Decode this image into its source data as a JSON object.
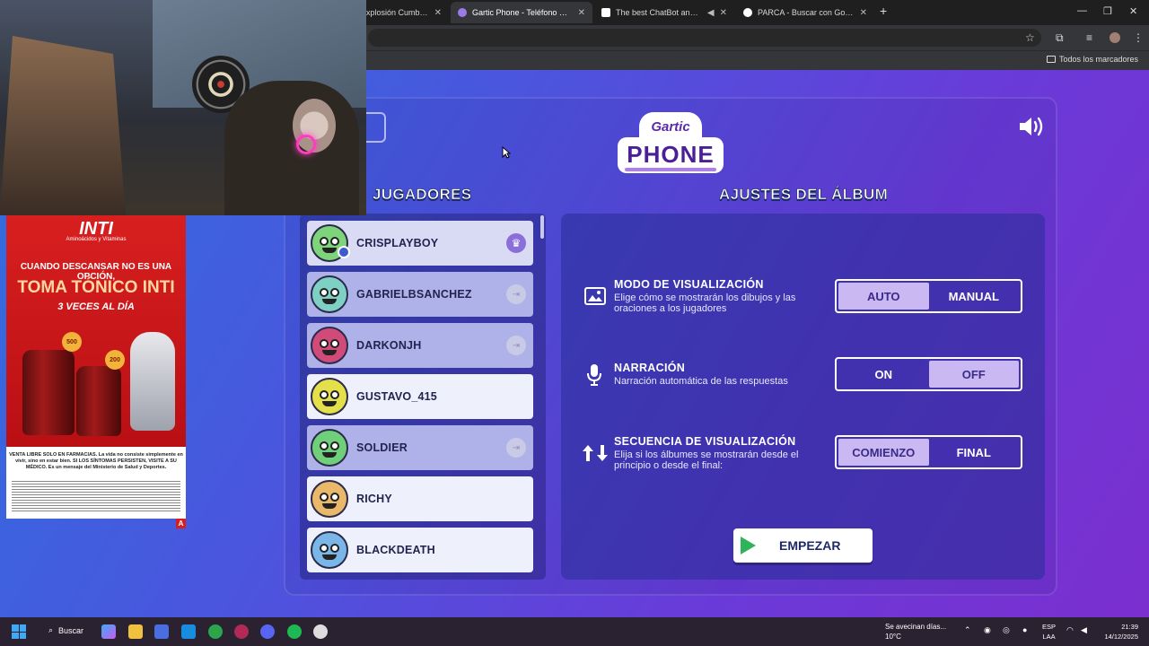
{
  "browser": {
    "tabs": [
      {
        "title": "xplosión Cumbiera",
        "active": false
      },
      {
        "title": "Gartic Phone - Teléfono Descon",
        "active": true
      },
      {
        "title": "The best ChatBot and Widg",
        "active": false
      },
      {
        "title": "PARCA - Buscar con Google",
        "active": false
      }
    ],
    "bookmarks_label": "Todos los marcadores"
  },
  "game": {
    "logo_top": "Gartic",
    "logo_bottom": "PHONE",
    "players_heading": "JUGADORES",
    "settings_heading": "AJUSTES DEL ÁLBUM",
    "players": [
      {
        "name": "CRISPLAYBOY",
        "color": "#7ed47a",
        "role": "host"
      },
      {
        "name": "GABRIELBSANCHEZ",
        "color": "#7fd0c4",
        "role": "kick"
      },
      {
        "name": "DARKONJH",
        "color": "#d04a7a",
        "role": "kick"
      },
      {
        "name": "GUSTAVO_415",
        "color": "#e3e04a",
        "role": "none"
      },
      {
        "name": "SOLDIER",
        "color": "#6fcf7a",
        "role": "kick"
      },
      {
        "name": "RICHY",
        "color": "#e9b86a",
        "role": "none"
      },
      {
        "name": "BLACKDEATH",
        "color": "#7ab7e8",
        "role": "none"
      }
    ],
    "settings": [
      {
        "title": "MODO DE VISUALIZACIÓN",
        "desc": "Elige cómo se mostrarán los dibujos y las oraciones a los jugadores",
        "options": [
          "AUTO",
          "MANUAL"
        ],
        "selected": 0,
        "icon": "image-icon"
      },
      {
        "title": "NARRACIÓN",
        "desc": "Narración automática de las respuestas",
        "options": [
          "ON",
          "OFF"
        ],
        "selected": 1,
        "icon": "microphone-icon"
      },
      {
        "title": "SECUENCIA DE VISUALIZACIÓN",
        "desc": "Elija si los álbumes se mostrarán desde el principio o desde el final:",
        "options": [
          "COMIENZO",
          "FINAL"
        ],
        "selected": 0,
        "icon": "sort-arrows-icon"
      }
    ],
    "start_label": "EMPEZAR"
  },
  "ad": {
    "brand": "INTI",
    "subtitle": "Aminoácidos y Vitaminas",
    "line1": "CUANDO DESCANSAR NO ES UNA OPCIÓN,",
    "line2": "TOMA TÓNICO INTI",
    "line3": "3 VECES AL DÍA",
    "size1": "500",
    "size2": "200",
    "footer": "VENTA LIBRE SOLO EN FARMACIAS. La vida no consiste simplemente en vivir, sino en estar bien. SI LOS SÍNTOMAS PERSISTEN, VISITE A SU MÉDICO. Es un mensaje del Ministerio de Salud y Deportes.",
    "flag": "A"
  },
  "taskbar": {
    "search_label": "Buscar",
    "weather_line1": "Se avecinan días...",
    "weather_line2": "10°C",
    "lang_line1": "ESP",
    "lang_line2": "LAA",
    "time": "21:39",
    "date": "14/12/2025"
  }
}
